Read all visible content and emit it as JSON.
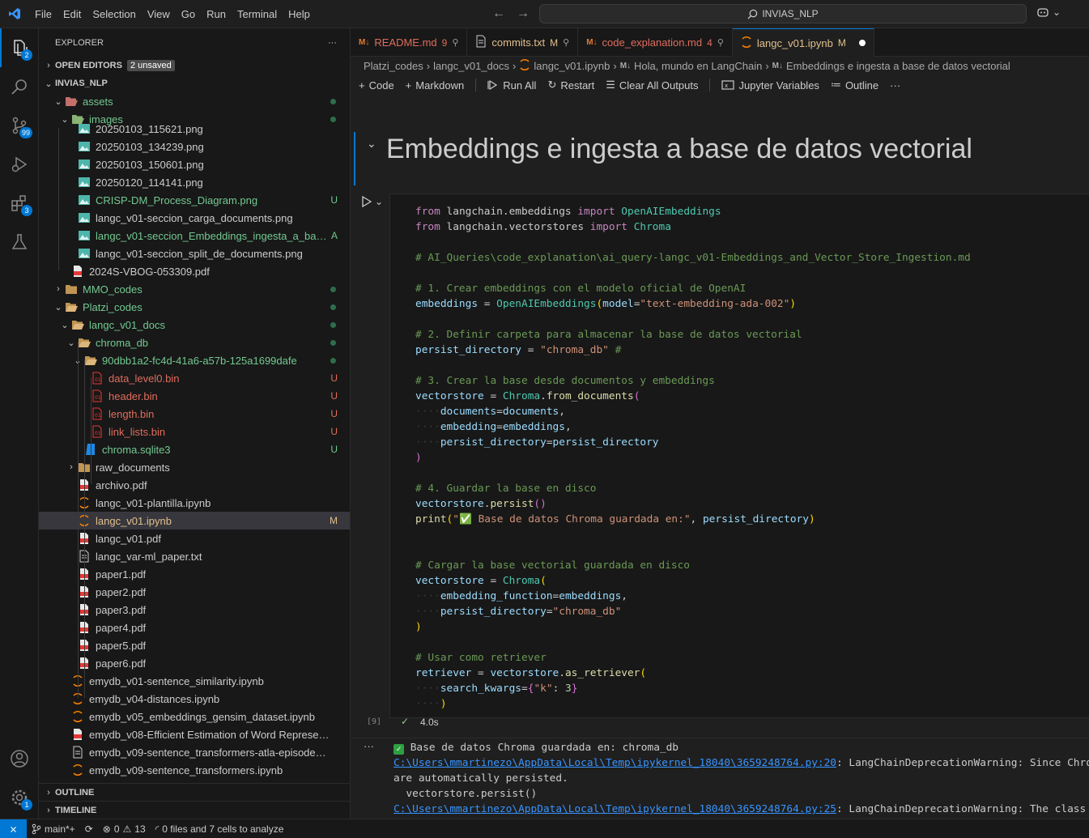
{
  "menu": [
    "File",
    "Edit",
    "Selection",
    "View",
    "Go",
    "Run",
    "Terminal",
    "Help"
  ],
  "search": {
    "text": "INVIAS_NLP"
  },
  "activity": {
    "explorer_badge": "2",
    "scm_badge": "99",
    "ext_badge": "3",
    "settings_badge": "1"
  },
  "sidebar": {
    "title": "EXPLORER",
    "more": "···",
    "open_editors": "OPEN EDITORS",
    "unsaved": "2 unsaved",
    "root": "INVIAS_NLP",
    "outline": "OUTLINE",
    "timeline": "TIMELINE"
  },
  "tree": [
    {
      "label": "assets",
      "stat": "dot",
      "color": "green"
    },
    {
      "label": "images",
      "stat": "dot",
      "color": "green"
    },
    {
      "label": "20250103_115621.png",
      "stat": "",
      "color": "plain"
    },
    {
      "label": "20250103_134239.png",
      "stat": "",
      "color": "plain"
    },
    {
      "label": "20250103_150601.png",
      "stat": "",
      "color": "plain"
    },
    {
      "label": "20250120_114141.png",
      "stat": "",
      "color": "plain"
    },
    {
      "label": "CRISP-DM_Process_Diagram.png",
      "stat": "U",
      "color": "green"
    },
    {
      "label": "langc_v01-seccion_carga_documents.png",
      "stat": "",
      "color": "plain"
    },
    {
      "label": "langc_v01-seccion_Embeddings_ingesta_a_base...",
      "stat": "A",
      "color": "green"
    },
    {
      "label": "langc_v01-seccion_split_de_documents.png",
      "stat": "",
      "color": "plain"
    },
    {
      "label": "2024S-VBOG-053309.pdf",
      "stat": "",
      "color": "plain"
    },
    {
      "label": "MMO_codes",
      "stat": "dot",
      "color": "green"
    },
    {
      "label": "Platzi_codes",
      "stat": "dot",
      "color": "green"
    },
    {
      "label": "langc_v01_docs",
      "stat": "dot",
      "color": "green"
    },
    {
      "label": "chroma_db",
      "stat": "dot",
      "color": "green"
    },
    {
      "label": "90dbb1a2-fc4d-41a6-a57b-125a1699dafe",
      "stat": "dot",
      "color": "green"
    },
    {
      "label": "data_level0.bin",
      "stat": "U",
      "color": "orange"
    },
    {
      "label": "header.bin",
      "stat": "U",
      "color": "orange"
    },
    {
      "label": "length.bin",
      "stat": "U",
      "color": "orange"
    },
    {
      "label": "link_lists.bin",
      "stat": "U",
      "color": "orange"
    },
    {
      "label": "chroma.sqlite3",
      "stat": "U",
      "color": "green"
    },
    {
      "label": "raw_documents",
      "stat": "",
      "color": "plain"
    },
    {
      "label": "archivo.pdf",
      "stat": "",
      "color": "plain"
    },
    {
      "label": "langc_v01-plantilla.ipynb",
      "stat": "",
      "color": "plain"
    },
    {
      "label": "langc_v01.ipynb",
      "stat": "M",
      "color": "yellow"
    },
    {
      "label": "langc_v01.pdf",
      "stat": "",
      "color": "plain"
    },
    {
      "label": "langc_var-ml_paper.txt",
      "stat": "",
      "color": "plain"
    },
    {
      "label": "paper1.pdf",
      "stat": "",
      "color": "plain"
    },
    {
      "label": "paper2.pdf",
      "stat": "",
      "color": "plain"
    },
    {
      "label": "paper3.pdf",
      "stat": "",
      "color": "plain"
    },
    {
      "label": "paper4.pdf",
      "stat": "",
      "color": "plain"
    },
    {
      "label": "paper5.pdf",
      "stat": "",
      "color": "plain"
    },
    {
      "label": "paper6.pdf",
      "stat": "",
      "color": "plain"
    },
    {
      "label": "emydb_v01-sentence_similarity.ipynb",
      "stat": "",
      "color": "plain"
    },
    {
      "label": "emydb_v04-distances.ipynb",
      "stat": "",
      "color": "plain"
    },
    {
      "label": "emydb_v05_embeddings_gensim_dataset.ipynb",
      "stat": "",
      "color": "plain"
    },
    {
      "label": "emydb_v08-Efficient Estimation of Word Representati...",
      "stat": "",
      "color": "plain"
    },
    {
      "label": "emydb_v09-sentence_transformers-atla-episodes-scri...",
      "stat": "",
      "color": "plain"
    },
    {
      "label": "emydb_v09-sentence_transformers.ipynb",
      "stat": "",
      "color": "plain"
    }
  ],
  "tabs": [
    {
      "label": "README.md",
      "stat": "9",
      "color": "orange"
    },
    {
      "label": "commits.txt",
      "stat": "M",
      "color": "yellow"
    },
    {
      "label": "code_explanation.md",
      "stat": "4",
      "color": "orange"
    },
    {
      "label": "langc_v01.ipynb",
      "stat": "M",
      "color": "yellow"
    }
  ],
  "breadcrumb": [
    "Platzi_codes",
    "langc_v01_docs",
    "langc_v01.ipynb",
    "Hola, mundo en LangChain",
    "Embeddings e ingesta a base de datos vectorial"
  ],
  "toolbar": {
    "code": "Code",
    "markdown": "Markdown",
    "run_all": "Run All",
    "restart": "Restart",
    "clear": "Clear All Outputs",
    "variables": "Jupyter Variables",
    "outline": "Outline",
    "more": "···"
  },
  "markdown_heading": "Embeddings e ingesta a base de datos vectorial",
  "cell": {
    "exec_count": "[9]",
    "duration": "4.0s"
  },
  "output": {
    "line1": "Base de datos Chroma guardada en: chroma_db",
    "link1": "C:\\Users\\mmartinezo\\AppData\\Local\\Temp\\ipykernel_18040\\3659248764.py:20",
    "warn1": ": LangChainDeprecationWarning: Since Chro",
    "line3": "are automatically persisted.",
    "line4": "  vectorstore.persist()",
    "link2": "C:\\Users\\mmartinezo\\AppData\\Local\\Temp\\ipykernel_18040\\3659248764.py:25",
    "warn2": ": LangChainDeprecationWarning: The class"
  },
  "status": {
    "branch": "main*+",
    "errors": "0",
    "warnings": "13",
    "analysis": "0 files and 7 cells to analyze"
  }
}
